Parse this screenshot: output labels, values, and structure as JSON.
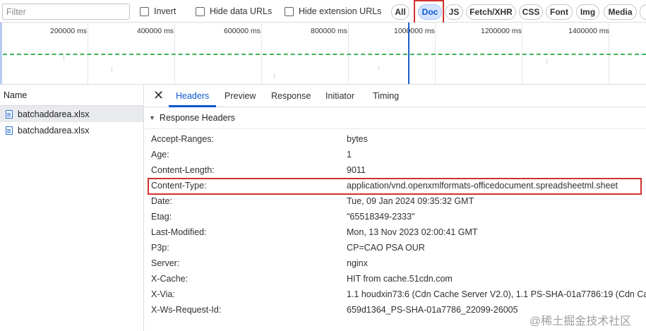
{
  "filter": {
    "placeholder": "Filter"
  },
  "checkboxes": [
    {
      "label": "Invert",
      "checked": false
    },
    {
      "label": "Hide data URLs",
      "checked": false
    },
    {
      "label": "Hide extension URLs",
      "checked": false
    }
  ],
  "type_filters": [
    {
      "label": "All",
      "active": false
    },
    {
      "label": "Doc",
      "active": true
    },
    {
      "label": "JS",
      "active": false
    },
    {
      "label": "Fetch/XHR",
      "active": false
    },
    {
      "label": "CSS",
      "active": false
    },
    {
      "label": "Font",
      "active": false
    },
    {
      "label": "Img",
      "active": false
    },
    {
      "label": "Media",
      "active": false
    }
  ],
  "timeline": {
    "ticks": [
      "200000 ms",
      "400000 ms",
      "600000 ms",
      "800000 ms",
      "1000000 ms",
      "1200000 ms",
      "1400000 ms"
    ]
  },
  "requests": {
    "header": "Name",
    "items": [
      {
        "name": "batchaddarea.xlsx",
        "selected": true
      },
      {
        "name": "batchaddarea.xlsx",
        "selected": false
      }
    ]
  },
  "detail": {
    "close_icon": "close-icon",
    "tabs": [
      "Headers",
      "Preview",
      "Response",
      "Initiator",
      "Timing"
    ],
    "active_tab": "Headers",
    "section_title": "Response Headers",
    "headers": [
      {
        "name": "Accept-Ranges:",
        "value": "bytes"
      },
      {
        "name": "Age:",
        "value": "1"
      },
      {
        "name": "Content-Length:",
        "value": "9011"
      },
      {
        "name": "Content-Type:",
        "value": "application/vnd.openxmlformats-officedocument.spreadsheetml.sheet",
        "highlighted": true
      },
      {
        "name": "Date:",
        "value": "Tue, 09 Jan 2024 09:35:32 GMT"
      },
      {
        "name": "Etag:",
        "value": "\"65518349-2333\""
      },
      {
        "name": "Last-Modified:",
        "value": "Mon, 13 Nov 2023 02:00:41 GMT"
      },
      {
        "name": "P3p:",
        "value": "CP=CAO PSA OUR"
      },
      {
        "name": "Server:",
        "value": "nginx"
      },
      {
        "name": "X-Cache:",
        "value": "HIT from cache.51cdn.com"
      },
      {
        "name": "X-Via:",
        "value": "1.1 houdxin73:6 (Cdn Cache Server V2.0), 1.1 PS-SHA-01a7786:19 (Cdn Ca"
      },
      {
        "name": "X-Ws-Request-Id:",
        "value": "659d1364_PS-SHA-01a7786_22099-26005"
      }
    ]
  },
  "watermark": "@稀土掘金技术社区",
  "colors": {
    "accent": "#0b57d0",
    "highlight_box": "#d0322f",
    "timeline_dash": "#3fb55a",
    "timeline_marker": "#1a5fc9"
  }
}
